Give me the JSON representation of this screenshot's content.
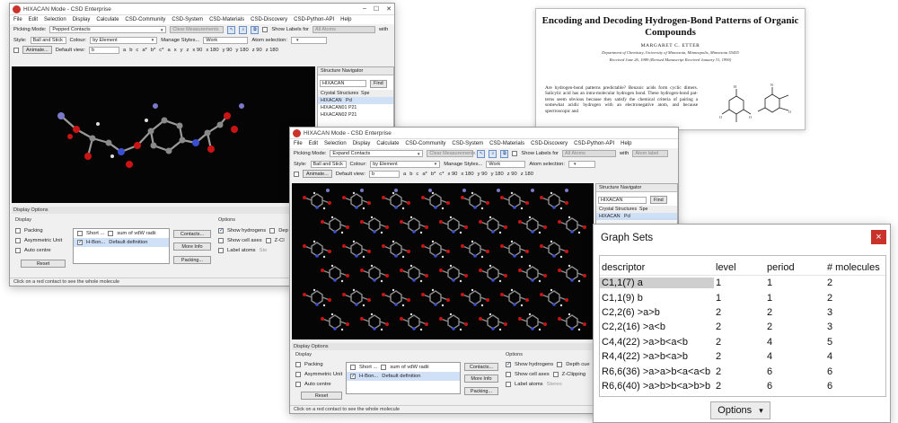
{
  "win1": {
    "title": "HIXACAN Mode - CSD Enterprise",
    "menu": [
      "File",
      "Edit",
      "Selection",
      "Display",
      "Calculate",
      "CSD-Community",
      "CSD-System",
      "CSD-Materials",
      "CSD-Discovery",
      "CSD-Python-API",
      "Help"
    ],
    "picking_label": "Picking Mode:",
    "picking_value": "Pepped Contacts",
    "clear_measurements": "Clear Measurements",
    "show_labels": "Show Labels for",
    "labels_value": "All Atoms",
    "labels_suffix": "with",
    "style_label": "Style:",
    "style_value": "Ball and Stick",
    "colour_label": "Colour:",
    "colour_value": "by Element",
    "manage_styles": "Manage Styles...",
    "manage_value": "Work",
    "atom_selection": "Atom selection:",
    "animate": "Animate...",
    "default_view": "Default view:",
    "default_view_value": "b",
    "axis_buttons": [
      "a",
      "b",
      "c",
      "a*",
      "b*",
      "c*",
      "a",
      "x",
      "y",
      "z",
      "x 90",
      "x 180",
      "y 90",
      "y 180",
      "z 90",
      "z 180"
    ],
    "nav_header": "Structure Navigator",
    "nav_search": "HIXACAN",
    "nav_find": "Find",
    "nav_col1": "Crystal Structures",
    "nav_col2": "Spe",
    "nav_items": [
      [
        "HIXACAN",
        "Pcl"
      ],
      [
        "HIXACAN01",
        "P21"
      ],
      [
        "HIXACAN02",
        "P21"
      ]
    ],
    "display_options": "Display Options",
    "display_title": "Display",
    "packing": "Packing",
    "asymmetric_unit": "Asymmetric Unit",
    "auto_centre": "Auto centre",
    "reset": "Reset",
    "contact_short": "Short ...",
    "contact_short_val": "sum of vdW radii",
    "contact_hbond": "H-Bon...",
    "contact_hbond_val": "Default definition",
    "contacts_btn": "Contacts...",
    "more_info": "More Info",
    "packing_btn": "Packing...",
    "options_title": "Options",
    "show_hydrogens": "Show hydrogens",
    "show_cell_axes": "Show cell axes",
    "label_atoms": "Label atoms",
    "depth_cue": "Dep",
    "z_clip": "Z-Cl",
    "stereo": "Ste",
    "status": "Click on a red contact to see the whole molecule"
  },
  "win2": {
    "title": "HIXACAN Mode - CSD Enterprise",
    "menu": [
      "File",
      "Edit",
      "Selection",
      "Display",
      "Calculate",
      "CSD-Community",
      "CSD-System",
      "CSD-Materials",
      "CSD-Discovery",
      "CSD-Python-API",
      "Help"
    ],
    "picking_label": "Picking Mode:",
    "picking_value": "Expand Contacts",
    "clear_measurements": "Clear Measurements",
    "show_labels": "Show Labels for",
    "labels_value": "All Atoms",
    "labels_suffix": "with",
    "labels_extra": "Atom label",
    "style_label": "Style:",
    "style_value": "Ball and Stick",
    "colour_label": "Colour:",
    "colour_value": "by Element",
    "manage_styles": "Manage Styles...",
    "manage_value": "Work",
    "atom_selection": "Atom selection:",
    "animate": "Animate...",
    "default_view": "Default view:",
    "default_view_value": "b",
    "axis_buttons": [
      "a",
      "b",
      "c",
      "a*",
      "b*",
      "c*",
      "x 90",
      "x 180",
      "y 90",
      "y 180",
      "z 90",
      "z 180"
    ],
    "nav_header": "Structure Navigator",
    "nav_search": "HIXACAN",
    "nav_find": "Find",
    "nav_col1": "Crystal Structures",
    "nav_col2": "Spe",
    "nav_items": [
      [
        "HIXACAN",
        "Pcl"
      ]
    ],
    "display_options": "Display Options",
    "display_title": "Display",
    "packing": "Packing",
    "asymmetric_unit": "Asymmetric Unit",
    "auto_centre": "Auto centre",
    "reset": "Reset",
    "contact_short": "Short ...",
    "contact_short_val": "sum of vdW radii",
    "contact_hbond": "H-Bon...",
    "contact_hbond_val": "Default definition",
    "contacts_btn": "Contacts...",
    "more_info": "More Info",
    "packing_btn": "Packing...",
    "options_title": "Options",
    "show_hydrogens": "Show hydrogens",
    "show_cell_axes": "Show cell axes",
    "label_atoms": "Label atoms",
    "depth_cue": "Depth cue",
    "z_clip": "Z-Clipping",
    "stereo": "Stereo",
    "status": "Click on a red contact to see the whole molecule"
  },
  "paper": {
    "title": "Encoding and Decoding Hydrogen-Bond Patterns of Organic Compounds",
    "author": "MARGARET C. ETTER",
    "affiliation": "Department of Chemistry, University of Minnesota, Minneapolis, Minnesota 55455",
    "received": "Received June 26, 1989 (Revised Manuscript Received January 31, 1990)",
    "body": "Are hydrogen-bond patterns predictable? Benzoic acids form cyclic dimers. Salicylic acid has an intra-molecular hydrogen bond. These hydrogen-bond pat-terns seem obvious because they satisfy the chemical criteria of pairing a somewhat acidic hydrogen with an electronegative atom, and because spectroscopic and"
  },
  "graph_sets": {
    "title": "Graph Sets",
    "close": "×",
    "columns": [
      "descriptor",
      "level",
      "period",
      "# molecules"
    ],
    "rows": [
      [
        "C1,1(7) a",
        "1",
        "1",
        "2"
      ],
      [
        "C1,1(9) b",
        "1",
        "1",
        "2"
      ],
      [
        "C2,2(6) >a>b",
        "2",
        "2",
        "3"
      ],
      [
        "C2,2(16) >a<b",
        "2",
        "2",
        "3"
      ],
      [
        "C4,4(22) >a>b<a<b",
        "2",
        "4",
        "5"
      ],
      [
        "R4,4(22) >a>b<a>b",
        "2",
        "4",
        "4"
      ],
      [
        "R6,6(36) >a>a>b<a<a<b",
        "2",
        "6",
        "6"
      ],
      [
        "R6,6(40) >a>b>b<a>b>b",
        "2",
        "6",
        "6"
      ]
    ],
    "options_label": "Options",
    "options_arrow": "▾"
  },
  "colors": {
    "close_red": "#c8332c",
    "viewport_bg": "#050505",
    "selection": "#cfcfcf"
  }
}
